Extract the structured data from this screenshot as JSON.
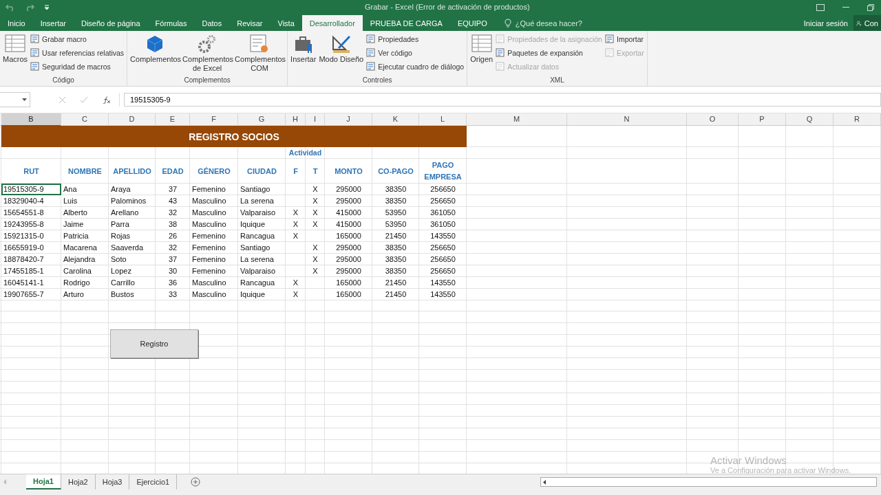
{
  "window": {
    "title": "Grabar - Excel (Error de activación de productos)"
  },
  "ribbon_tabs": [
    {
      "label": "Inicio",
      "selected": false
    },
    {
      "label": "Insertar",
      "selected": false
    },
    {
      "label": "Diseño de página",
      "selected": false
    },
    {
      "label": "Fórmulas",
      "selected": false
    },
    {
      "label": "Datos",
      "selected": false
    },
    {
      "label": "Revisar",
      "selected": false
    },
    {
      "label": "Vista",
      "selected": false
    },
    {
      "label": "Desarrollador",
      "selected": true
    },
    {
      "label": "PRUEBA DE CARGA",
      "selected": false
    },
    {
      "label": "EQUIPO",
      "selected": false
    }
  ],
  "search": {
    "placeholder": "¿Qué desea hacer?"
  },
  "account": {
    "sign_in": "Iniciar sesión",
    "share": "Con"
  },
  "ribbon_groups": [
    {
      "label": "Código",
      "items": [
        {
          "label": "Macros",
          "kind": "large",
          "disabled": false
        },
        {
          "label": "Grabar macro",
          "kind": "small",
          "disabled": false
        },
        {
          "label": "Usar referencias relativas",
          "kind": "small",
          "disabled": false
        },
        {
          "label": "Seguridad de macros",
          "kind": "small",
          "disabled": false
        }
      ]
    },
    {
      "label": "Complementos",
      "items": [
        {
          "label": "Complementos",
          "kind": "large",
          "disabled": false
        },
        {
          "label": "Complementos de Excel",
          "kind": "large",
          "disabled": false
        },
        {
          "label": "Complementos COM",
          "kind": "large",
          "disabled": false
        }
      ]
    },
    {
      "label": "Controles",
      "items": [
        {
          "label": "Insertar",
          "kind": "large",
          "disabled": false
        },
        {
          "label": "Modo Diseño",
          "kind": "large",
          "disabled": false
        },
        {
          "label": "Propiedades",
          "kind": "small",
          "disabled": false
        },
        {
          "label": "Ver código",
          "kind": "small",
          "disabled": false
        },
        {
          "label": "Ejecutar cuadro de diálogo",
          "kind": "small",
          "disabled": false
        }
      ]
    },
    {
      "label": "XML",
      "items": [
        {
          "label": "Origen",
          "kind": "large",
          "disabled": false
        },
        {
          "label": "Propiedades de la asignación",
          "kind": "small",
          "disabled": true
        },
        {
          "label": "Paquetes de expansión",
          "kind": "small",
          "disabled": false
        },
        {
          "label": "Actualizar datos",
          "kind": "small",
          "disabled": true
        },
        {
          "label": "Importar",
          "kind": "small",
          "disabled": false
        },
        {
          "label": "Exportar",
          "kind": "small",
          "disabled": true
        }
      ]
    }
  ],
  "formula_bar": {
    "value": "19515305-9"
  },
  "columns": [
    {
      "letter": "B",
      "selected": true
    },
    {
      "letter": "C",
      "selected": false
    },
    {
      "letter": "D",
      "selected": false
    },
    {
      "letter": "E",
      "selected": false
    },
    {
      "letter": "F",
      "selected": false
    },
    {
      "letter": "G",
      "selected": false
    },
    {
      "letter": "H",
      "selected": false
    },
    {
      "letter": "I",
      "selected": false
    },
    {
      "letter": "J",
      "selected": false
    },
    {
      "letter": "K",
      "selected": false
    },
    {
      "letter": "L",
      "selected": false
    },
    {
      "letter": "M",
      "selected": false
    },
    {
      "letter": "N",
      "selected": false
    },
    {
      "letter": "O",
      "selected": false
    },
    {
      "letter": "P",
      "selected": false
    },
    {
      "letter": "Q",
      "selected": false
    },
    {
      "letter": "R",
      "selected": false
    }
  ],
  "sheet": {
    "title": "REGISTRO SOCIOS",
    "group_label": "Actividad",
    "headers": [
      "RUT",
      "NOMBRE",
      "APELLIDO",
      "EDAD",
      "GÉNERO",
      "CIUDAD",
      "F",
      "T",
      "MONTO",
      "CO-PAGO",
      "PAGO EMPRESA"
    ],
    "rows": [
      {
        "rut": "19515305-9",
        "nombre": "Ana",
        "apellido": "Araya",
        "edad": "37",
        "genero": "Femenino",
        "ciudad": "Santiago",
        "t": "X",
        "monto": "295000",
        "copago": "38350",
        "pago": "256650",
        "selected": true
      },
      {
        "rut": "18329040-4",
        "nombre": "Luis",
        "apellido": "Palominos",
        "edad": "43",
        "genero": "Masculino",
        "ciudad": "La serena",
        "t": "X",
        "monto": "295000",
        "copago": "38350",
        "pago": "256650",
        "selected": false
      },
      {
        "rut": "15654551-8",
        "nombre": "Alberto",
        "apellido": "Arellano",
        "edad": "32",
        "genero": "Masculino",
        "ciudad": "Valparaiso",
        "f": "X",
        "t": "X",
        "monto": "415000",
        "copago": "53950",
        "pago": "361050",
        "selected": false
      },
      {
        "rut": "19243955-8",
        "nombre": "Jaime",
        "apellido": "Parra",
        "edad": "38",
        "genero": "Masculino",
        "ciudad": "Iquique",
        "f": "X",
        "t": "X",
        "monto": "415000",
        "copago": "53950",
        "pago": "361050",
        "selected": false
      },
      {
        "rut": "15921315-0",
        "nombre": "Patricia",
        "apellido": "Rojas",
        "edad": "26",
        "genero": "Femenino",
        "ciudad": "Rancagua",
        "f": "X",
        "monto": "165000",
        "copago": "21450",
        "pago": "143550",
        "selected": false
      },
      {
        "rut": "16655919-0",
        "nombre": "Macarena",
        "apellido": "Saaverda",
        "edad": "32",
        "genero": "Femenino",
        "ciudad": "Santiago",
        "t": "X",
        "monto": "295000",
        "copago": "38350",
        "pago": "256650",
        "selected": false
      },
      {
        "rut": "18878420-7",
        "nombre": "Alejandra",
        "apellido": "Soto",
        "edad": "37",
        "genero": "Femenino",
        "ciudad": "La serena",
        "t": "X",
        "monto": "295000",
        "copago": "38350",
        "pago": "256650",
        "selected": false
      },
      {
        "rut": "17455185-1",
        "nombre": "Carolina",
        "apellido": "Lopez",
        "edad": "30",
        "genero": "Femenino",
        "ciudad": "Valparaiso",
        "t": "X",
        "monto": "295000",
        "copago": "38350",
        "pago": "256650",
        "selected": false
      },
      {
        "rut": "16045141-1",
        "nombre": "Rodrigo",
        "apellido": "Carrillo",
        "edad": "36",
        "genero": "Masculino",
        "ciudad": "Rancagua",
        "f": "X",
        "monto": "165000",
        "copago": "21450",
        "pago": "143550",
        "selected": false
      },
      {
        "rut": "19907655-7",
        "nombre": "Arturo",
        "apellido": "Bustos",
        "edad": "33",
        "genero": "Masculino",
        "ciudad": "Iquique",
        "f": "X",
        "monto": "165000",
        "copago": "21450",
        "pago": "143550",
        "selected": false
      }
    ]
  },
  "form_button": {
    "label": "Registro"
  },
  "sheet_tabs": [
    {
      "label": "Hoja1",
      "selected": true
    },
    {
      "label": "Hoja2",
      "selected": false
    },
    {
      "label": "Hoja3",
      "selected": false
    },
    {
      "label": "Ejercicio1",
      "selected": false
    }
  ],
  "activation_notice": {
    "title": "Activar Windows",
    "subtitle": "Ve a Configuración para activar Windows."
  }
}
